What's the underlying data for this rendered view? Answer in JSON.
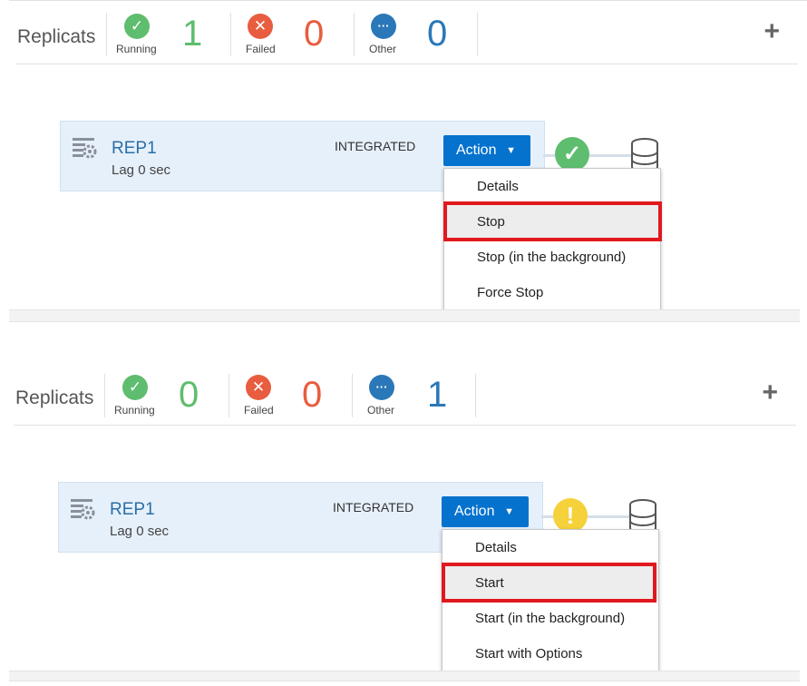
{
  "panels": [
    {
      "title": "Replicats",
      "stats": {
        "running": {
          "label": "Running",
          "count": "1",
          "icon": "check-icon"
        },
        "failed": {
          "label": "Failed",
          "count": "0",
          "icon": "x-icon"
        },
        "other": {
          "label": "Other",
          "count": "0",
          "icon": "ellipsis-icon"
        }
      },
      "add_icon": "plus-icon",
      "replicat": {
        "name": "REP1",
        "lag": "Lag 0 sec",
        "type": "INTEGRATED"
      },
      "action_label": "Action",
      "status": "running",
      "menu_items": [
        "Details",
        "Stop",
        "Stop (in the background)",
        "Force Stop"
      ],
      "highlighted_item": "Stop"
    },
    {
      "title": "Replicats",
      "stats": {
        "running": {
          "label": "Running",
          "count": "0",
          "icon": "check-icon"
        },
        "failed": {
          "label": "Failed",
          "count": "0",
          "icon": "x-icon"
        },
        "other": {
          "label": "Other",
          "count": "1",
          "icon": "ellipsis-icon"
        }
      },
      "add_icon": "plus-icon",
      "replicat": {
        "name": "REP1",
        "lag": "Lag 0 sec",
        "type": "INTEGRATED"
      },
      "action_label": "Action",
      "status": "warning",
      "menu_items": [
        "Details",
        "Start",
        "Start (in the background)",
        "Start with Options"
      ],
      "highlighted_item": "Start"
    }
  ],
  "colors": {
    "running": "#5ebd6e",
    "failed": "#e85d3f",
    "other": "#2a78b8",
    "warning": "#f5d13a",
    "action": "#0572ce",
    "highlight_border": "#e0191f"
  }
}
